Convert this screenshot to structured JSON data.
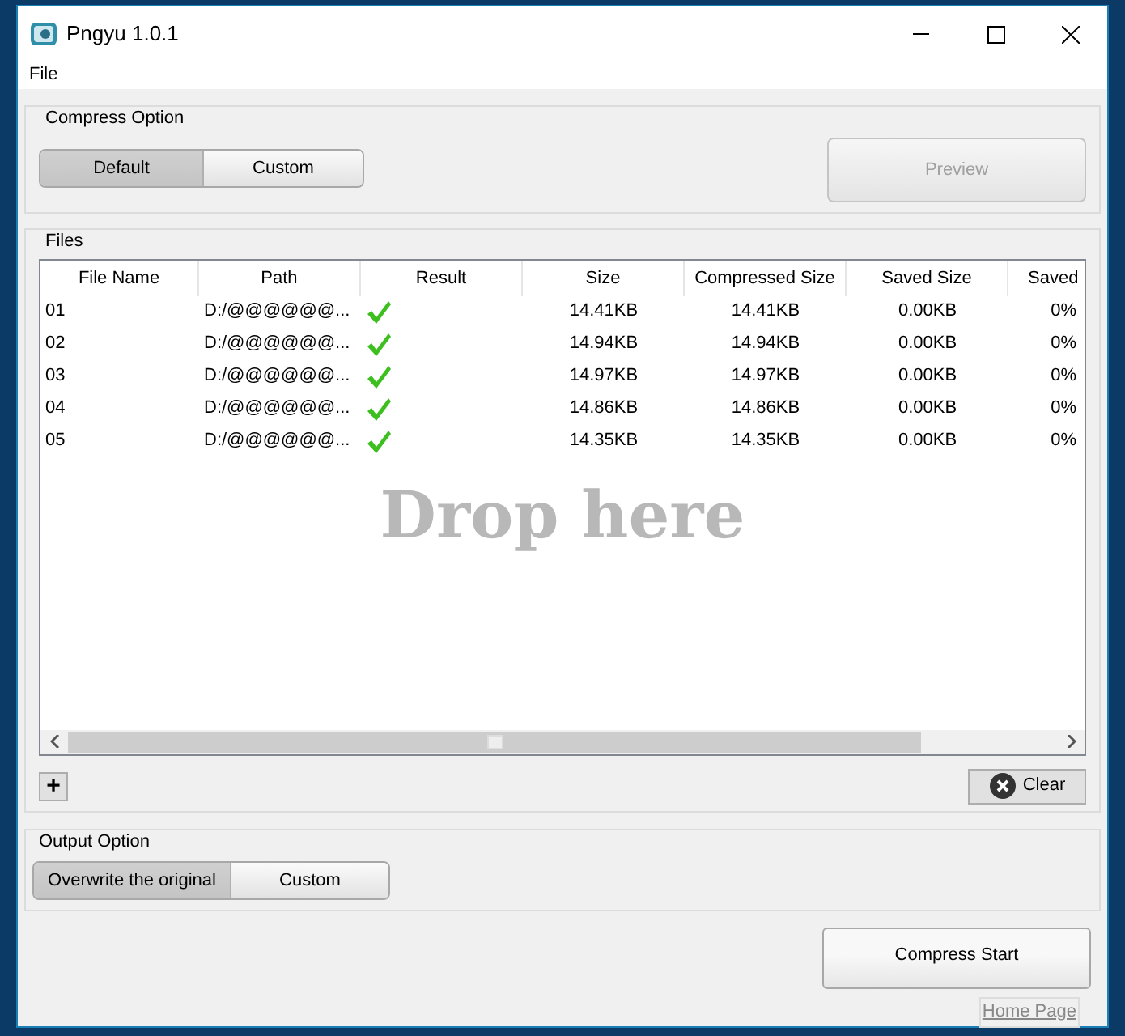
{
  "window": {
    "title": "Pngyu 1.0.1"
  },
  "menu": [
    "File"
  ],
  "compress_option": {
    "title": "Compress Option",
    "modes": [
      {
        "label": "Default",
        "selected": true
      },
      {
        "label": "Custom",
        "selected": false
      }
    ],
    "preview_button": {
      "label": "Preview",
      "disabled": true
    }
  },
  "files": {
    "title": "Files",
    "columns": [
      "File Name",
      "Path",
      "Result",
      "Size",
      "Compressed Size",
      "Saved Size",
      "Saved"
    ],
    "rows": [
      {
        "file_name": "01",
        "path": "D:/@@@@@@...",
        "succeeded": true,
        "size": "14.41KB",
        "compressed_size": "14.41KB",
        "saved_size": "0.00KB",
        "saved_percent": "0%"
      },
      {
        "file_name": "02",
        "path": "D:/@@@@@@...",
        "succeeded": true,
        "size": "14.94KB",
        "compressed_size": "14.94KB",
        "saved_size": "0.00KB",
        "saved_percent": "0%"
      },
      {
        "file_name": "03",
        "path": "D:/@@@@@@...",
        "succeeded": true,
        "size": "14.97KB",
        "compressed_size": "14.97KB",
        "saved_size": "0.00KB",
        "saved_percent": "0%"
      },
      {
        "file_name": "04",
        "path": "D:/@@@@@@...",
        "succeeded": true,
        "size": "14.86KB",
        "compressed_size": "14.86KB",
        "saved_size": "0.00KB",
        "saved_percent": "0%"
      },
      {
        "file_name": "05",
        "path": "D:/@@@@@@...",
        "succeeded": true,
        "size": "14.35KB",
        "compressed_size": "14.35KB",
        "saved_size": "0.00KB",
        "saved_percent": "0%"
      }
    ],
    "drop_hint": "Drop here",
    "add_button": "+",
    "clear_button": "Clear"
  },
  "output_option": {
    "title": "Output Option",
    "modes": [
      {
        "label": "Overwrite the original",
        "selected": true
      },
      {
        "label": "Custom",
        "selected": false
      }
    ]
  },
  "compress_button": "Compress Start",
  "home_page_link": "Home Page"
}
